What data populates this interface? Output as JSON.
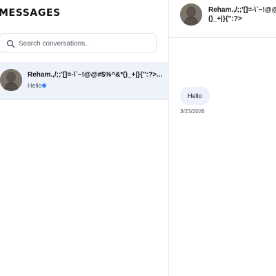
{
  "sidebar": {
    "title": "MESSAGES",
    "search": {
      "placeholder": "Search conversations..",
      "value": ""
    },
    "conversations": [
      {
        "name": "Reham.,/;;'[]=-\\`~!@@#$%^&*()_+|}{\":?>...",
        "preview": "Hello",
        "unread": true,
        "selected": true
      }
    ]
  },
  "chat": {
    "header": {
      "name": "Reham.,/;;'[]=-\\`~!@@#$%^&*()_+|}{\":?>"
    },
    "messages": [
      {
        "text": "Hello",
        "date": "3/23/2026"
      }
    ]
  },
  "colors": {
    "selected_row": "#eef2fb",
    "unread_dot": "#3b82f6",
    "bubble": "#eef1fb",
    "border": "#e5e7eb"
  },
  "icons": {
    "search": "search-icon",
    "avatar": "avatar"
  }
}
